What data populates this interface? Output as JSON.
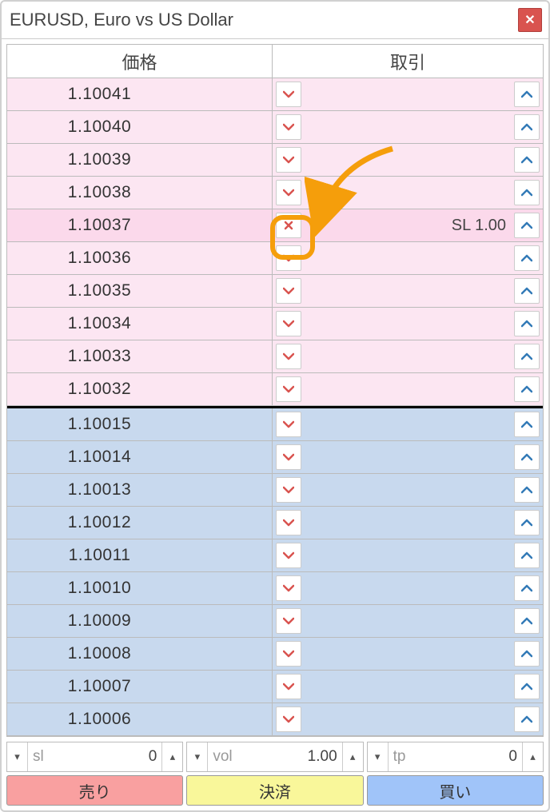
{
  "title": "EURUSD, Euro vs US Dollar",
  "headers": {
    "price": "価格",
    "trade": "取引"
  },
  "rows": [
    {
      "price": "1.10041",
      "side": "ask"
    },
    {
      "price": "1.10040",
      "side": "ask"
    },
    {
      "price": "1.10039",
      "side": "ask"
    },
    {
      "price": "1.10038",
      "side": "ask"
    },
    {
      "price": "1.10037",
      "side": "ask",
      "highlight": true,
      "x_btn": true,
      "label": "SL 1.00"
    },
    {
      "price": "1.10036",
      "side": "ask"
    },
    {
      "price": "1.10035",
      "side": "ask"
    },
    {
      "price": "1.10034",
      "side": "ask"
    },
    {
      "price": "1.10033",
      "side": "ask"
    },
    {
      "price": "1.10032",
      "side": "ask",
      "last_ask": true
    },
    {
      "price": "1.10015",
      "side": "bid"
    },
    {
      "price": "1.10014",
      "side": "bid"
    },
    {
      "price": "1.10013",
      "side": "bid"
    },
    {
      "price": "1.10012",
      "side": "bid"
    },
    {
      "price": "1.10011",
      "side": "bid"
    },
    {
      "price": "1.10010",
      "side": "bid"
    },
    {
      "price": "1.10009",
      "side": "bid"
    },
    {
      "price": "1.10008",
      "side": "bid"
    },
    {
      "price": "1.10007",
      "side": "bid"
    },
    {
      "price": "1.10006",
      "side": "bid"
    }
  ],
  "sl": {
    "label": "sl",
    "value": "0"
  },
  "vol": {
    "label": "vol",
    "value": "1.00"
  },
  "tp": {
    "label": "tp",
    "value": "0"
  },
  "actions": {
    "sell": "売り",
    "settle": "決済",
    "buy": "買い"
  }
}
